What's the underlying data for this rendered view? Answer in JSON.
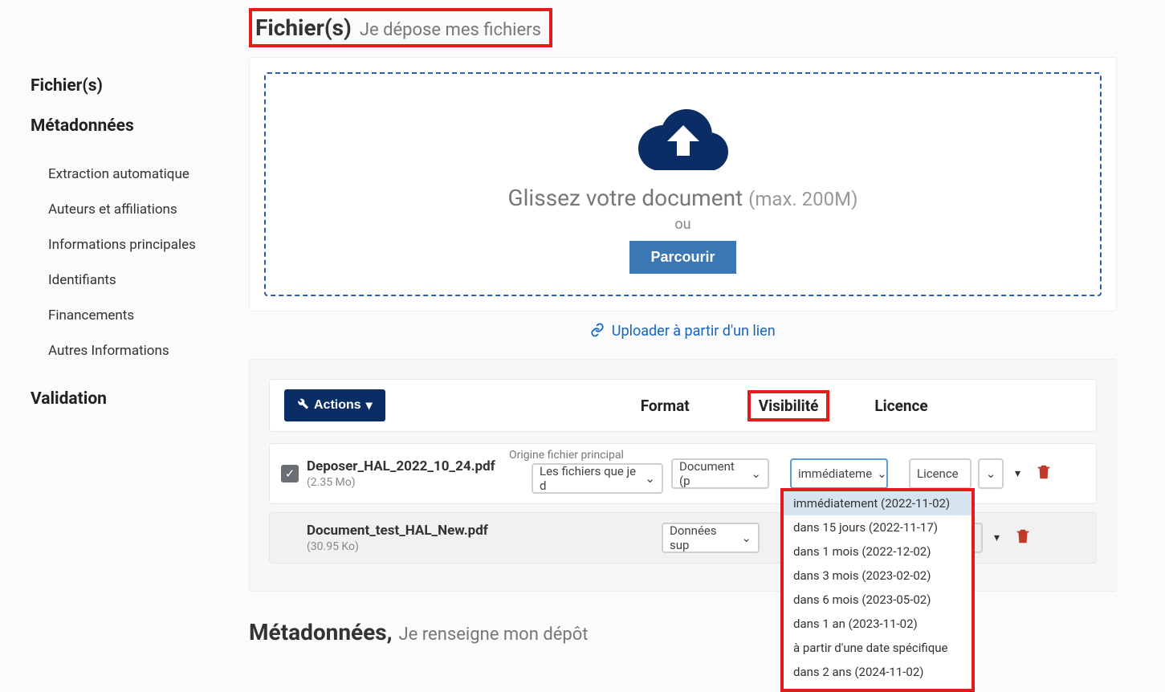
{
  "sidebar": {
    "sections": [
      {
        "label": "Fichier(s)",
        "items": []
      },
      {
        "label": "Métadonnées",
        "items": [
          {
            "label": "Extraction automatique"
          },
          {
            "label": "Auteurs et affiliations"
          },
          {
            "label": "Informations principales"
          },
          {
            "label": "Identifiants"
          },
          {
            "label": "Financements"
          },
          {
            "label": "Autres Informations"
          }
        ]
      },
      {
        "label": "Validation",
        "items": []
      }
    ]
  },
  "page": {
    "title": "Fichier(s)",
    "subtitle": "Je dépose mes fichiers"
  },
  "dropzone": {
    "text_main": "Glissez votre document",
    "text_size": "(max. 200M)",
    "or": "ou",
    "browse": "Parcourir",
    "upload_link": "Uploader à partir d'un lien"
  },
  "table": {
    "actions_label": "Actions",
    "headers": {
      "format": "Format",
      "visibility": "Visibilité",
      "licence": "Licence"
    },
    "origin_label": "Origine fichier principal",
    "rows": [
      {
        "checked": true,
        "filename": "Deposer_HAL_2022_10_24.pdf",
        "size": "(2.35 Mo)",
        "origin": "Les fichiers que je d",
        "format": "Document (p",
        "visibility": "immédiateme",
        "licence": "Licence"
      },
      {
        "checked": false,
        "filename": "Document_test_HAL_New.pdf",
        "size": "(30.95 Ko)",
        "origin": "",
        "format": "Données sup",
        "visibility": "",
        "licence": ""
      }
    ],
    "visibility_options": [
      "immédiatement (2022-11-02)",
      "dans 15 jours (2022-11-17)",
      "dans 1 mois (2022-12-02)",
      "dans 3 mois (2023-02-02)",
      "dans 6 mois (2023-05-02)",
      "dans 1 an (2023-11-02)",
      "à partir d'une date spécifique",
      "dans 2 ans (2024-11-02)"
    ]
  },
  "section2": {
    "title": "Métadonnées,",
    "subtitle": "Je renseigne mon dépôt"
  }
}
